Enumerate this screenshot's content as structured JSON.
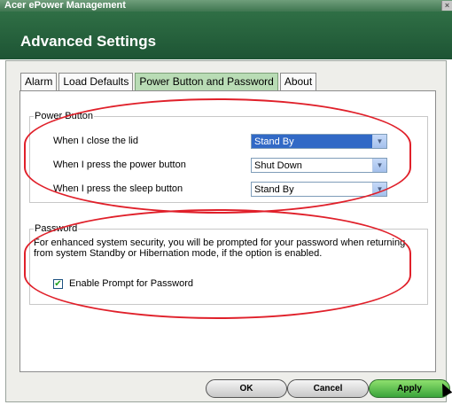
{
  "window": {
    "title": "Acer ePower Management",
    "close_glyph": "×"
  },
  "header": {
    "title": "Advanced Settings"
  },
  "tabs": [
    {
      "label": "Alarm"
    },
    {
      "label": "Load Defaults"
    },
    {
      "label": "Power Button and Password",
      "active": true
    },
    {
      "label": "About"
    }
  ],
  "power_button": {
    "title": "Power Button",
    "rows": [
      {
        "label": "When I close the lid",
        "value": "Stand By",
        "selected": true
      },
      {
        "label": "When I press the power button",
        "value": "Shut Down"
      },
      {
        "label": "When I press the sleep button",
        "value": "Stand By"
      }
    ]
  },
  "password": {
    "title": "Password",
    "description": "For enhanced system security, you will be prompted for your password when returning from system Standby or Hibernation mode, if the option is enabled.",
    "checkbox_label": "Enable Prompt for Password",
    "checkbox_checked": true
  },
  "buttons": {
    "ok": "OK",
    "cancel": "Cancel",
    "apply": "Apply"
  },
  "colors": {
    "header": "#1d5434",
    "active_tab": "#b9dcb5",
    "highlight": "#e0202a",
    "selection": "#3169c6"
  },
  "icons": {
    "dropdown": "chevron-down-icon",
    "check": "checkmark-icon",
    "close": "close-icon"
  }
}
